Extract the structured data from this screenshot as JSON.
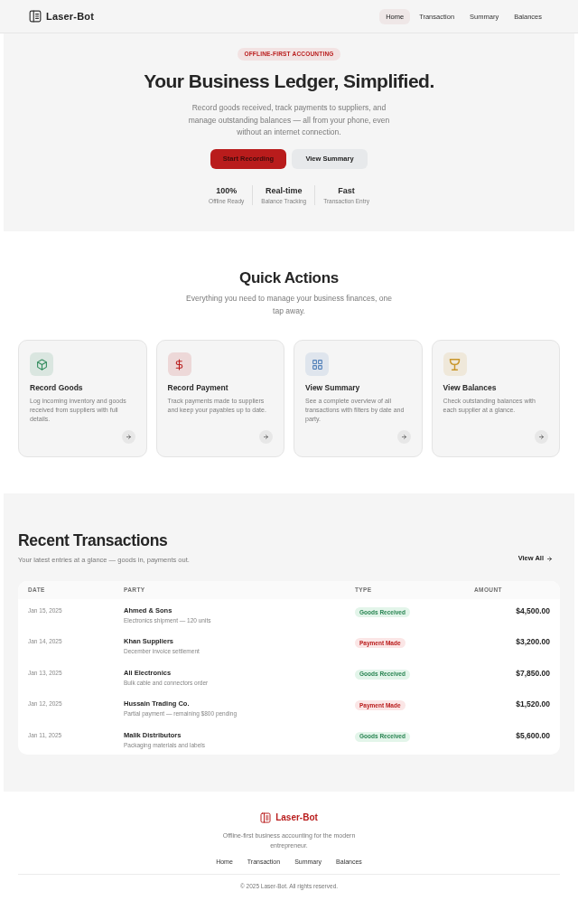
{
  "header": {
    "brand": "Laser-Bot",
    "nav": [
      {
        "label": "Home",
        "selected": true
      },
      {
        "label": "Transaction",
        "selected": false
      },
      {
        "label": "Summary",
        "selected": false
      },
      {
        "label": "Balances",
        "selected": false
      }
    ]
  },
  "hero": {
    "badge": "OFFLINE-FIRST ACCOUNTING",
    "title": "Your Business Ledger, Simplified.",
    "description": "Record goods received, track payments to suppliers, and manage outstanding balances — all from your phone, even without an internet connection.",
    "buttons": [
      {
        "label": "Start Recording",
        "kind": "primary"
      },
      {
        "label": "View Summary",
        "kind": "secondary"
      }
    ],
    "stats": [
      {
        "value": "100%",
        "label": "Offline Ready"
      },
      {
        "value": "Real-time",
        "label": "Balance Tracking"
      },
      {
        "value": "Fast",
        "label": "Transaction Entry"
      }
    ]
  },
  "quick_actions": {
    "title": "Quick Actions",
    "subtitle": "Everything you need to manage your business finances, one tap away.",
    "cards": [
      {
        "title": "Record Goods",
        "description": "Log incoming inventory and goods received from suppliers with full details.",
        "color": "#2f8a5b"
      },
      {
        "title": "Record Payment",
        "description": "Track payments made to suppliers and keep your payables up to date.",
        "color": "#b91c1c"
      },
      {
        "title": "View Summary",
        "description": "See a complete overview of all transactions with filters by date and party.",
        "color": "#4f7fb8"
      },
      {
        "title": "View Balances",
        "description": "Check outstanding balances with each supplier at a glance.",
        "color": "#c9962a"
      }
    ]
  },
  "recent_transactions": {
    "title": "Recent Transactions",
    "subtitle": "Your latest entries at a glance — goods in, payments out.",
    "view_all": "View All",
    "table": {
      "columns": [
        "DATE",
        "PARTY",
        "TYPE",
        "AMOUNT"
      ],
      "rows": [
        {
          "date": "Jan 15, 2025",
          "party": "Ahmed & Sons",
          "note": "Electronics shipment — 120 units",
          "type": {
            "label": "Goods Received",
            "kind": "received"
          },
          "amount": "$4,500.00"
        },
        {
          "date": "Jan 14, 2025",
          "party": "Khan Suppliers",
          "note": "December invoice settlement",
          "type": {
            "label": "Payment Made",
            "kind": "payment"
          },
          "amount": "$3,200.00"
        },
        {
          "date": "Jan 13, 2025",
          "party": "Ali Electronics",
          "note": "Bulk cable and connectors order",
          "type": {
            "label": "Goods Received",
            "kind": "received"
          },
          "amount": "$7,850.00"
        },
        {
          "date": "Jan 12, 2025",
          "party": "Hussain Trading Co.",
          "note": "Partial payment — remaining $800 pending",
          "type": {
            "label": "Payment Made",
            "kind": "payment"
          },
          "amount": "$1,520.00"
        },
        {
          "date": "Jan 11, 2025",
          "party": "Malik Distributors",
          "note": "Packaging materials and labels",
          "type": {
            "label": "Goods Received",
            "kind": "received"
          },
          "amount": "$5,600.00"
        }
      ]
    }
  },
  "footer": {
    "brand": "Laser-Bot",
    "tagline": "Offline-first business accounting for the modern entrepreneur.",
    "links": [
      "Home",
      "Transaction",
      "Summary",
      "Balances"
    ],
    "copyright": "© 2025 Laser-Bot. All rights reserved."
  }
}
